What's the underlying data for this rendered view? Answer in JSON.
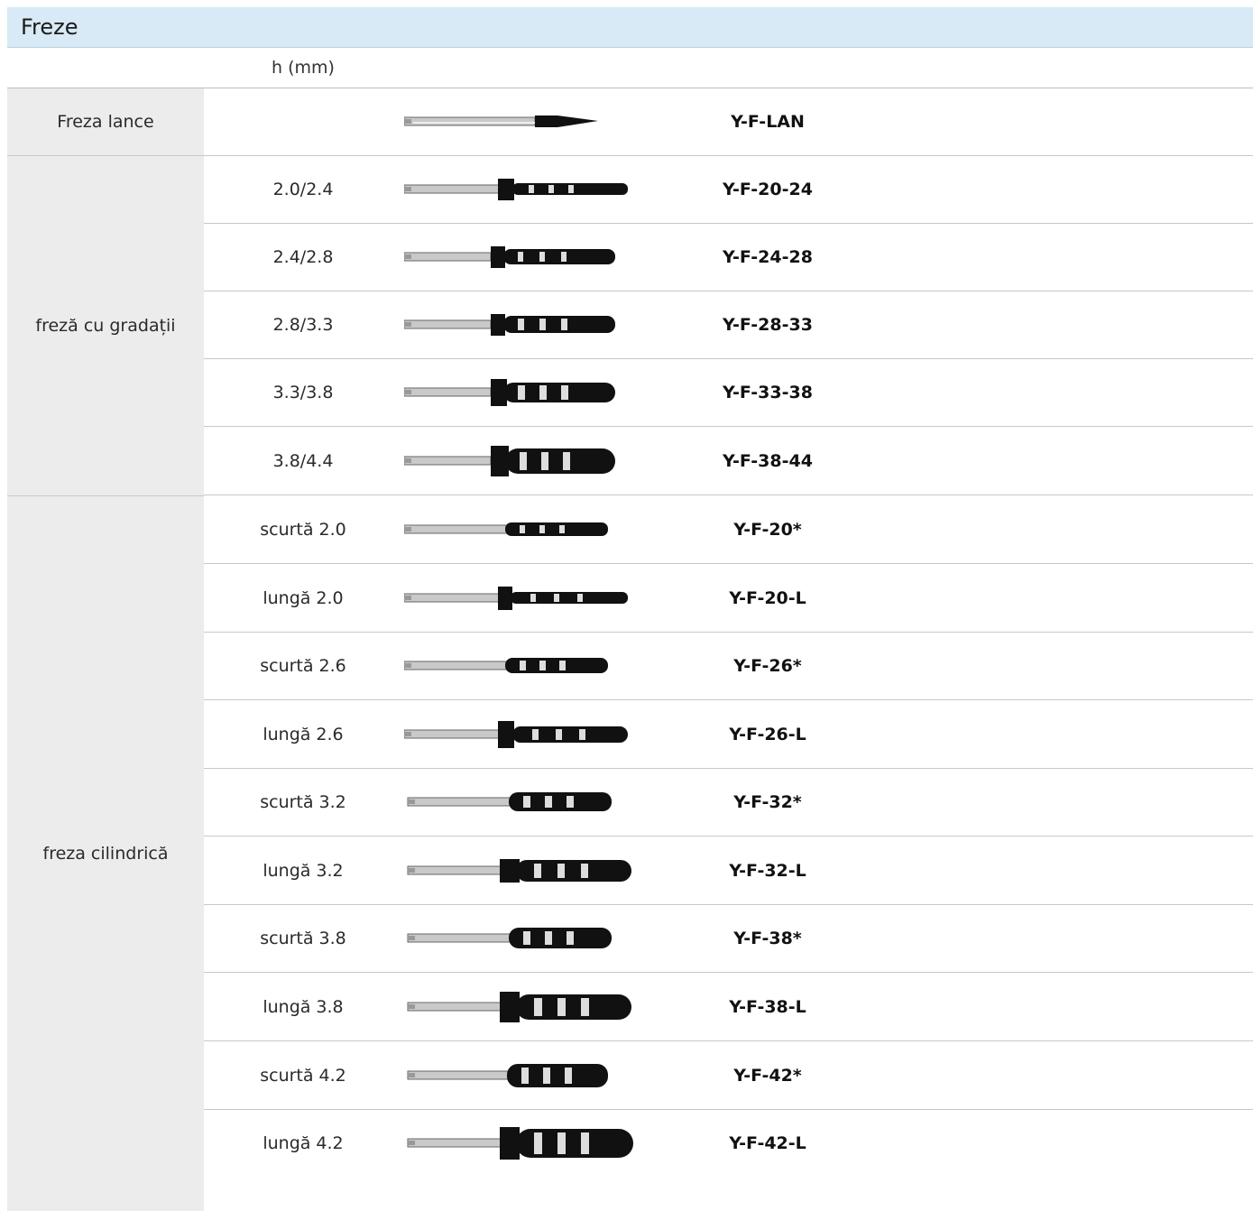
{
  "section": {
    "title": "Freze"
  },
  "header": {
    "h_label": "h (mm)"
  },
  "groups": [
    {
      "label": "Freza lance"
    },
    {
      "label": "freză cu gradații"
    },
    {
      "label": "freza cilindrică"
    }
  ],
  "rows": [
    {
      "dim": "",
      "code": "Y-F-LAN",
      "icon": "lance-drill-icon"
    },
    {
      "dim": "2.0/2.4",
      "code": "Y-F-20-24",
      "icon": "graduated-drill-icon"
    },
    {
      "dim": "2.4/2.8",
      "code": "Y-F-24-28",
      "icon": "graduated-drill-icon"
    },
    {
      "dim": "2.8/3.3",
      "code": "Y-F-28-33",
      "icon": "graduated-drill-icon"
    },
    {
      "dim": "3.3/3.8",
      "code": "Y-F-33-38",
      "icon": "graduated-drill-icon"
    },
    {
      "dim": "3.8/4.4",
      "code": "Y-F-38-44",
      "icon": "graduated-drill-icon"
    },
    {
      "dim": "scurtă 2.0",
      "code": "Y-F-20*",
      "icon": "cylindrical-drill-icon"
    },
    {
      "dim": "lungă 2.0",
      "code": "Y-F-20-L",
      "icon": "cylindrical-drill-icon"
    },
    {
      "dim": "scurtă 2.6",
      "code": "Y-F-26*",
      "icon": "cylindrical-drill-icon"
    },
    {
      "dim": "lungă 2.6",
      "code": "Y-F-26-L",
      "icon": "cylindrical-drill-icon"
    },
    {
      "dim": "scurtă 3.2",
      "code": "Y-F-32*",
      "icon": "cylindrical-drill-icon"
    },
    {
      "dim": "lungă 3.2",
      "code": "Y-F-32-L",
      "icon": "cylindrical-drill-icon"
    },
    {
      "dim": "scurtă 3.8",
      "code": "Y-F-38*",
      "icon": "cylindrical-drill-icon"
    },
    {
      "dim": "lungă 3.8",
      "code": "Y-F-38-L",
      "icon": "cylindrical-drill-icon"
    },
    {
      "dim": "scurtă 4.2",
      "code": "Y-F-42*",
      "icon": "cylindrical-drill-icon"
    },
    {
      "dim": "lungă 4.2",
      "code": "Y-F-42-L",
      "icon": "cylindrical-drill-icon"
    }
  ],
  "colors": {
    "title_bg": "#d7eaf6",
    "group_bg": "#ececec",
    "drill": "#111111",
    "shank": "#bdbdbd"
  }
}
